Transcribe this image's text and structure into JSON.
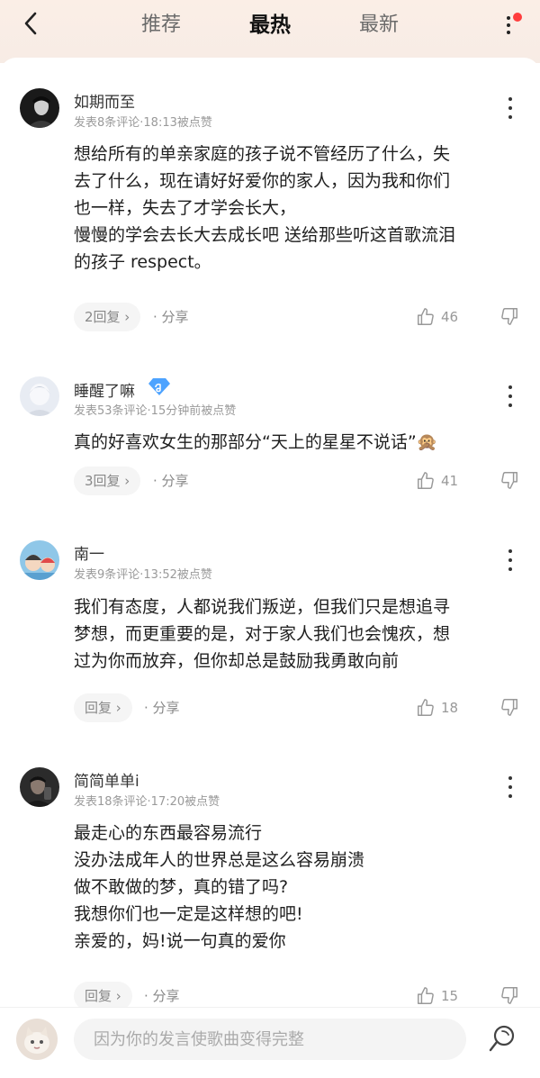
{
  "header": {
    "tabs": [
      "推荐",
      "最热",
      "最新"
    ],
    "active_tab": "最热"
  },
  "comments": [
    {
      "username": "如期而至",
      "meta": "发表8条评论·18:13被点赞",
      "lines": [
        "想给所有的单亲家庭的孩子说不管经历了什么，失",
        "去了什么，现在请好好爱你的家人，因为我和你们",
        "也一样，失去了才学会长大，",
        "慢慢的学会去长大去成长吧  送给那些听这首歌流泪",
        "的孩子  respect。"
      ],
      "reply_label": "2回复 ›",
      "share_label": "·  分享",
      "likes": "46"
    },
    {
      "username": "睡醒了嘛",
      "meta": "发表53条评论·15分钟前被点赞",
      "lines": [
        "真的好喜欢女生的那部分“天上的星星不说话”🙊"
      ],
      "reply_label": "3回复 ›",
      "share_label": "·  分享",
      "likes": "41"
    },
    {
      "username": "南一",
      "meta": "发表9条评论·13:52被点赞",
      "lines": [
        "我们有态度，人都说我们叛逆，但我们只是想追寻",
        "梦想，而更重要的是，对于家人我们也会愧疚，想",
        "过为你而放弃，但你却总是鼓励我勇敢向前"
      ],
      "reply_label": "回复 ›",
      "share_label": "·  分享",
      "likes": "18"
    },
    {
      "username": "简简单单i",
      "meta": "发表18条评论·17:20被点赞",
      "lines": [
        "最走心的东西最容易流行",
        "没办法成年人的世界总是这么容易崩溃",
        "做不敢做的梦，真的错了吗?",
        "我想你们也一定是这样想的吧!",
        "亲爱的，妈!说一句真的爱你"
      ],
      "reply_label": "回复 ›",
      "share_label": "·  分享",
      "likes": "15"
    }
  ],
  "input": {
    "placeholder": "因为你的发言使歌曲变得完整"
  },
  "colors": {
    "header_bg": "#f7ece5",
    "badge_red": "#ff3d3d",
    "vip_blue": "#4da3ff"
  },
  "icons": [
    "back-arrow-icon",
    "more-vertical-icon",
    "thumb-up-icon",
    "thumb-down-icon",
    "send-icon",
    "vip-diamond-icon"
  ]
}
